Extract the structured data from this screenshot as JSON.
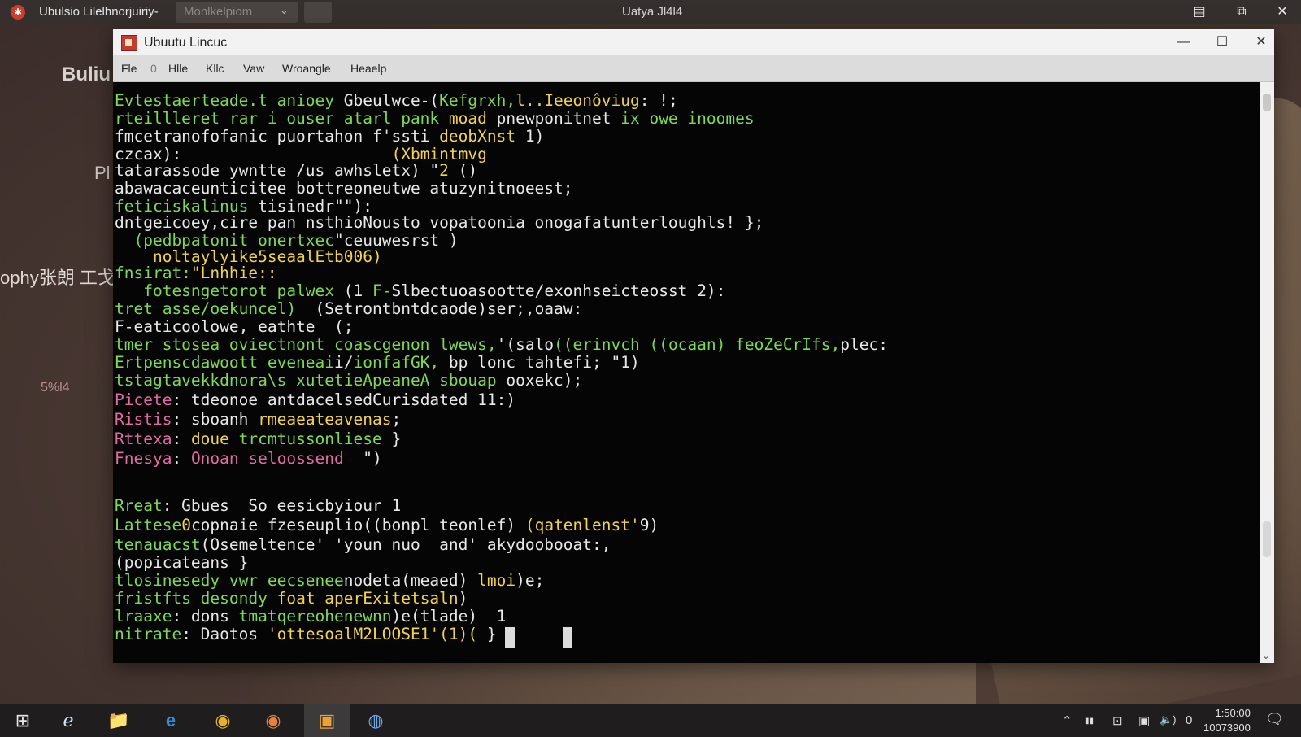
{
  "outer_bar": {
    "app_title": "Ubulsio Lilelhnorjuiriy-",
    "tab_label": "Monlkelpiom",
    "center_title": "Uatya Jl4l4",
    "controls": [
      "▤",
      "⧉",
      "✕"
    ]
  },
  "desktop": {
    "labels": [
      "Buliu",
      "Pl",
      "ophy",
      "5%l4",
      "ophy张朗 工戈"
    ]
  },
  "window": {
    "title": "Ubuutu  Lincuc",
    "controls": [
      "—",
      "☐",
      "✕"
    ],
    "menu": [
      "Fle",
      "0",
      "Hlle",
      "Kllc",
      "Vaw",
      "Wroangle",
      "Heaelp"
    ]
  },
  "terminal": {
    "lines": [
      {
        "y": 0,
        "segs": [
          {
            "c": "g",
            "t": "Evtestaerteade.t anioey "
          },
          {
            "c": "w",
            "t": "Gbeulwce-("
          },
          {
            "c": "g",
            "t": "Kefgrxh,"
          },
          {
            "c": "y",
            "t": "l..Ieeonôviug"
          },
          {
            "c": "w",
            "t": ": !;"
          }
        ]
      },
      {
        "y": 1,
        "segs": [
          {
            "c": "g",
            "t": "rteillleret rar i ouser atarl pank "
          },
          {
            "c": "y",
            "t": "moad "
          },
          {
            "c": "w",
            "t": "pnewponitnet "
          },
          {
            "c": "g",
            "t": "ix owe inoomes"
          }
        ]
      },
      {
        "y": 2,
        "segs": [
          {
            "c": "w",
            "t": "fmcetranofofanic puortahon "
          },
          {
            "c": "w",
            "t": "f'ssti "
          },
          {
            "c": "y",
            "t": "deobXnst "
          },
          {
            "c": "w",
            "t": "1)"
          }
        ]
      },
      {
        "y": 3,
        "segs": [
          {
            "c": "w",
            "t": "czcax):                      "
          },
          {
            "c": "y",
            "t": "(Xbmintmvg"
          }
        ]
      },
      {
        "y": 4,
        "segs": [
          {
            "c": "w",
            "t": "tatarassode ywntte /us awhsletx) \""
          },
          {
            "c": "y",
            "t": "2 "
          },
          {
            "c": "w",
            "t": "()"
          }
        ]
      },
      {
        "y": 5,
        "segs": [
          {
            "c": "w",
            "t": "abawacaceunticitee bottreoneutwe atuzynitnoeest;"
          }
        ]
      },
      {
        "y": 6,
        "segs": [
          {
            "c": "g",
            "t": "feticiskalinus "
          },
          {
            "c": "w",
            "t": "tisinedr\"\"):"
          }
        ]
      },
      {
        "y": 7,
        "segs": [
          {
            "c": "w",
            "t": "dntgeicoey,cire pan nsthioNousto vopatoonia onogafatunterloughls! };"
          }
        ]
      },
      {
        "y": 8,
        "segs": [
          {
            "c": "g",
            "t": "  (pedbpatonit onertxec"
          },
          {
            "c": "w",
            "t": "\"ceuuwesrst )"
          }
        ]
      },
      {
        "y": 9,
        "segs": [
          {
            "c": "y",
            "t": "    noltaylyike5seaalEtb006)"
          }
        ]
      },
      {
        "y": 10,
        "segs": [
          {
            "c": "g",
            "t": "fnsirat:"
          },
          {
            "c": "y",
            "t": "\"Lnhhie::"
          }
        ]
      },
      {
        "y": 11,
        "segs": [
          {
            "c": "g",
            "t": "   fotesngetorot palwex "
          },
          {
            "c": "w",
            "t": "(1 "
          },
          {
            "c": "g",
            "t": "F-"
          },
          {
            "c": "w",
            "t": "Slbectuoasootte/exonhseicteosst 2):"
          }
        ]
      },
      {
        "y": 12,
        "segs": [
          {
            "c": "g",
            "t": "tret asse/oekuncel)  "
          },
          {
            "c": "w",
            "t": "(Setrontbntdcaode)ser;,oaaw:"
          }
        ]
      },
      {
        "y": 13,
        "segs": [
          {
            "c": "w",
            "t": "F-eaticoolowe, eathte  (;"
          }
        ]
      },
      {
        "y": 14,
        "segs": [
          {
            "c": "g",
            "t": "tmer stosea oviectnont coascgenon lwews,"
          },
          {
            "c": "w",
            "t": "'(salo"
          },
          {
            "c": "g",
            "t": "((erinvch ((ocaan) feoZeCrIfs,"
          },
          {
            "c": "w",
            "t": "plec:"
          }
        ]
      },
      {
        "y": 15,
        "segs": [
          {
            "c": "g",
            "t": "Ertpenscdawoott eveneai"
          },
          {
            "c": "w",
            "t": "i/"
          },
          {
            "c": "g",
            "t": "ionfafGK, "
          },
          {
            "c": "w",
            "t": "bp lonc tahtefi; \"1)"
          }
        ]
      },
      {
        "y": 16,
        "segs": [
          {
            "c": "g",
            "t": "tstagtavekkdnora\\s xutetieApeaneA sbouap "
          },
          {
            "c": "w",
            "t": "ooxekc);"
          }
        ]
      },
      {
        "y": 17,
        "segs": [
          {
            "c": "p",
            "t": "Picete"
          },
          {
            "c": "w",
            "t": ": tdeonoe antdacelsedCurisdated 11:)"
          }
        ]
      },
      {
        "y": 18,
        "segs": [
          {
            "c": "p",
            "t": "Ristis"
          },
          {
            "c": "w",
            "t": ": sboanh "
          },
          {
            "c": "y",
            "t": "rmeaeateavenas"
          },
          {
            "c": "w",
            "t": ";"
          }
        ]
      },
      {
        "y": 19,
        "segs": [
          {
            "c": "p",
            "t": "Rttexa"
          },
          {
            "c": "w",
            "t": ": "
          },
          {
            "c": "y",
            "t": "doue "
          },
          {
            "c": "g",
            "t": "trcmtussonliese "
          },
          {
            "c": "w",
            "t": "}"
          }
        ]
      },
      {
        "y": 20,
        "segs": [
          {
            "c": "p",
            "t": "Fnesya"
          },
          {
            "c": "w",
            "t": ": "
          },
          {
            "c": "p",
            "t": "Onoan seloossend "
          },
          {
            "c": "w",
            "t": " \")"
          }
        ]
      },
      {
        "y": 22,
        "segs": [
          {
            "c": "g",
            "t": "Rreat"
          },
          {
            "c": "w",
            "t": ": Gbues  So eesicbyiour 1"
          }
        ]
      },
      {
        "y": 23,
        "segs": [
          {
            "c": "g",
            "t": "Lattese"
          },
          {
            "c": "y",
            "t": "0"
          },
          {
            "c": "w",
            "t": "copnaie fzeseuplio((bonpl teonlef) "
          },
          {
            "c": "y",
            "t": "(qatenlenst'"
          },
          {
            "c": "w",
            "t": "9)"
          }
        ]
      },
      {
        "y": 24,
        "segs": [
          {
            "c": "g",
            "t": "tenauacst"
          },
          {
            "c": "w",
            "t": "(Osemeltence' 'youn nuo  and' akydoobooat:,"
          }
        ]
      },
      {
        "y": 25,
        "segs": [
          {
            "c": "w",
            "t": "(popicateans }"
          }
        ]
      },
      {
        "y": 26,
        "segs": [
          {
            "c": "g",
            "t": "tlosinesedy vwr eecsenee"
          },
          {
            "c": "w",
            "t": "nodeta(meaed) "
          },
          {
            "c": "y",
            "t": "lmoi"
          },
          {
            "c": "w",
            "t": ")e;"
          }
        ]
      },
      {
        "y": 27,
        "segs": [
          {
            "c": "g",
            "t": "fristfts desondy "
          },
          {
            "c": "y",
            "t": "foat aperExitetsaln"
          },
          {
            "c": "w",
            "t": ")"
          }
        ]
      },
      {
        "y": 28,
        "segs": [
          {
            "c": "g",
            "t": "lraaxe"
          },
          {
            "c": "w",
            "t": ": dons "
          },
          {
            "c": "g",
            "t": "tmatqereohenewnn"
          },
          {
            "c": "w",
            "t": ")e(tlade)  1"
          }
        ]
      },
      {
        "y": 29,
        "segs": [
          {
            "c": "g",
            "t": "nitrate"
          },
          {
            "c": "w",
            "t": ": Daotos "
          },
          {
            "c": "y",
            "t": "'ottesoalM2LOOSE1'(1)( "
          },
          {
            "c": "w",
            "t": "}"
          }
        ]
      }
    ]
  },
  "taskbar": {
    "items": [
      "⊞",
      "ℯ",
      "📁",
      "e",
      "◉",
      "◉",
      "▣",
      "◍"
    ],
    "tray": [
      "⌃",
      "▮▮",
      "⊡",
      "▣",
      "🔈)",
      "0"
    ],
    "clock_time": "1:50:00",
    "clock_date": "10073900"
  }
}
